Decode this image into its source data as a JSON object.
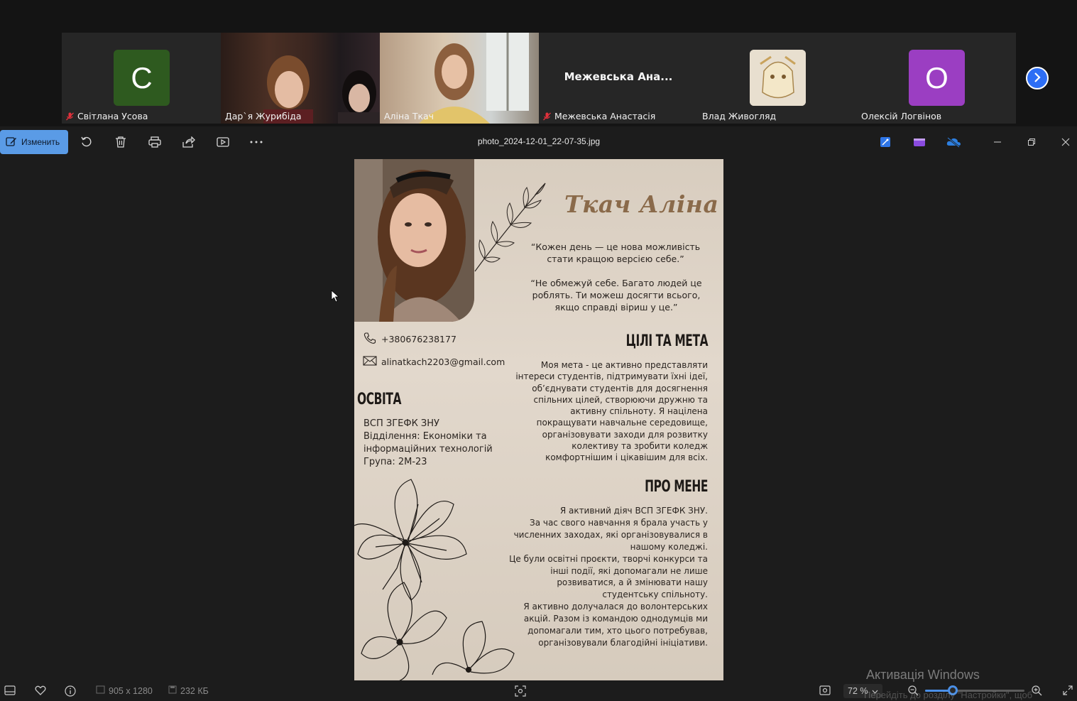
{
  "participants": [
    {
      "name": "Світлана Усова",
      "initial": "С",
      "avatar_color": "#2e5a1f",
      "muted": true,
      "type": "letter"
    },
    {
      "name": "Дар`я Журибіда",
      "muted": false,
      "type": "video"
    },
    {
      "name": "Аліна Ткач",
      "muted": false,
      "type": "video",
      "speaking": true
    },
    {
      "name": "Межевська Анастасія",
      "display": "Межевська  Ана...",
      "muted": true,
      "type": "name"
    },
    {
      "name": "Влад Живогляд",
      "muted": false,
      "type": "image"
    },
    {
      "name": "Олексій Логвінов",
      "initial": "О",
      "avatar_color": "#9b3ec2",
      "muted": false,
      "type": "letter"
    }
  ],
  "toolbar": {
    "edit_label": "Изменить",
    "file_name": "photo_2024-12-01_22-07-35.jpg"
  },
  "resume": {
    "name": "Ткач Аліна",
    "quote1": "“Кожен день — це нова можливість стати кращою версією себе.”",
    "quote2": "“Не обмежуй себе. Багато людей це роблять. Ти можеш досягти всього, якщо справді віриш у це.”",
    "phone": "+380676238177",
    "email": "alinatkach2203@gmail.com",
    "education_title": "ОСВІТА",
    "education_lines": [
      "ВСП ЗГЕФК ЗНУ",
      "Відділення: Економіки та",
      "інформаційних технологій",
      "Група: 2М-23"
    ],
    "goals_title": "ЦІЛІ ТА МЕТА",
    "goals_lines": [
      "Моя мета - це активно представляти",
      "інтереси студентів, підтримувати їхні ідеї,",
      "об’єднувати студентів для досягнення",
      "спільних цілей, створюючи дружню та",
      "активну спільноту. Я націлена",
      "покращувати навчальне середовище,",
      "організовувати заходи для розвитку",
      "колективу та зробити коледж",
      "комфортнішим і цікавішим для всіх."
    ],
    "about_title": "ПРО МЕНЕ",
    "about_lines": [
      "Я активний діяч ВСП ЗГЕФК ЗНУ.",
      "За час свого навчання я брала участь у",
      "численних заходах, які організовувалися в",
      "нашому коледжі.",
      "Це були освітні проєкти, творчі конкурси та",
      "інші події, які допомагали не лише",
      "розвиватися, а й змінювати нашу",
      "студентську спільноту.",
      "Я активно долучалася до волонтерських",
      "акцій. Разом із командою однодумців ми",
      "допомагали тим, хто цього потребував,",
      "організовували благодійні ініціативи."
    ]
  },
  "status": {
    "dimensions": "905 x 1280",
    "file_size": "232 КБ",
    "zoom": "72 %",
    "zoom_fraction": 0.28
  },
  "watermark": {
    "title": "Активація Windows",
    "subtitle": "Перейдіть до розділу \"Настройки\", щоб"
  }
}
